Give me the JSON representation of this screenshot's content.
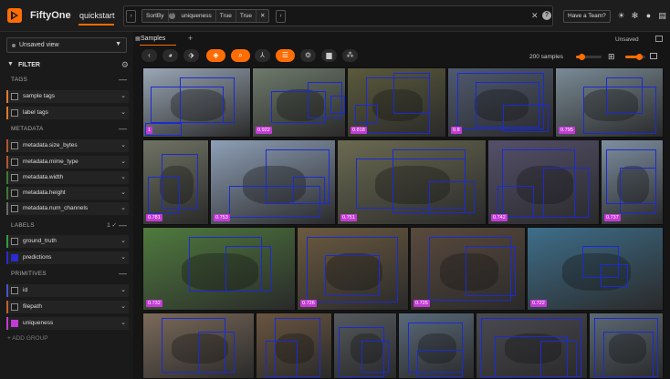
{
  "app": {
    "brand": "FiftyOne",
    "dataset": "quickstart",
    "have_team": "Have a Team?"
  },
  "view_bar": {
    "stage_name": "SortBy",
    "param_field": "uniqueness",
    "param_1": "True",
    "param_2": "True"
  },
  "sidebar": {
    "saved_view": "Unsaved view",
    "filter_title": "FILTER",
    "add_group": "+ ADD GROUP",
    "sections": [
      {
        "title": "TAGS",
        "rows": [
          {
            "label": "sample tags",
            "color": "#e07a2b"
          },
          {
            "label": "label tags",
            "color": "#e07a2b"
          }
        ]
      },
      {
        "title": "METADATA",
        "rows": [
          {
            "label": "metadata.size_bytes",
            "color": "#b3562b"
          },
          {
            "label": "metadata.mime_type",
            "color": "#b3562b"
          },
          {
            "label": "metadata.width",
            "color": "#3b7a32"
          },
          {
            "label": "metadata.height",
            "color": "#3b7a32"
          },
          {
            "label": "metadata.num_channels",
            "color": "#6a6a6a"
          }
        ]
      },
      {
        "title": "LABELS",
        "count": "1",
        "rows": [
          {
            "label": "ground_truth",
            "color": "#2f9e3f",
            "checked": false
          },
          {
            "label": "predictions",
            "color": "#2a2bd0",
            "checked": true
          }
        ]
      },
      {
        "title": "PRIMITIVES",
        "rows": [
          {
            "label": "id",
            "color": "#4a55c8"
          },
          {
            "label": "filepath",
            "color": "#c2602b"
          },
          {
            "label": "uniqueness",
            "color": "#c23bd4",
            "checked": true
          }
        ]
      }
    ]
  },
  "main": {
    "tab_samples": "Samples",
    "unsaved": "Unsaved",
    "sample_count": "200 samples"
  },
  "tiles": [
    {
      "conf": "1",
      "color": "#9aa7b5"
    },
    {
      "conf": "0.922",
      "color": "#6d7a6b"
    },
    {
      "conf": "0.818",
      "color": "#5b5a3c"
    },
    {
      "conf": "0.8",
      "color": "#4f5a70"
    },
    {
      "conf": "0.795",
      "color": "#7a8a95"
    },
    {
      "conf": "0.781",
      "color": "#6f7363"
    },
    {
      "conf": "0.753",
      "color": "#8e9fb6"
    },
    {
      "conf": "0.751",
      "color": "#6a6a52"
    },
    {
      "conf": "0.742",
      "color": "#54506a"
    },
    {
      "conf": "0.737",
      "color": "#7e8fa0"
    },
    {
      "conf": "0.732",
      "color": "#4f7a3e"
    },
    {
      "conf": "0.726",
      "color": "#6b5a40"
    },
    {
      "conf": "0.725",
      "color": "#5a4a3d"
    },
    {
      "conf": "0.722",
      "color": "#3e6e8a"
    },
    {
      "conf": "",
      "color": "#7b6a5a"
    },
    {
      "conf": "",
      "color": "#6a5540"
    },
    {
      "conf": "",
      "color": "#55595e"
    },
    {
      "conf": "",
      "color": "#5a6a7a"
    },
    {
      "conf": "",
      "color": "#4a4a52"
    },
    {
      "conf": "",
      "color": "#5d6a75"
    }
  ]
}
